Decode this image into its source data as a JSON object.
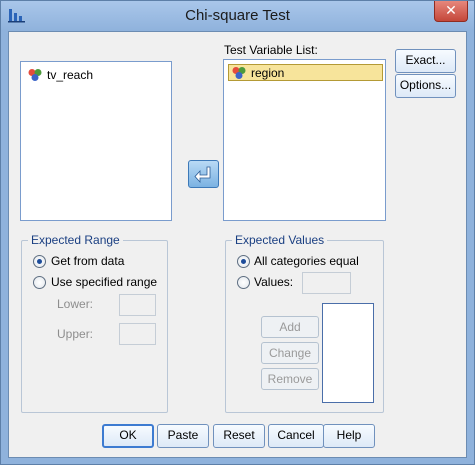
{
  "window": {
    "title": "Chi-square Test",
    "close_glyph": "✕"
  },
  "source_list": {
    "items": [
      {
        "label": "tv_reach",
        "icon": "nominal-variable-icon"
      }
    ]
  },
  "test_variable_list": {
    "label": "Test Variable List:",
    "items": [
      {
        "label": "region",
        "icon": "nominal-variable-icon",
        "selected": true
      }
    ]
  },
  "side_buttons": {
    "exact": "Exact...",
    "options": "Options..."
  },
  "expected_range": {
    "title": "Expected Range",
    "get_from_data": "Get from data",
    "get_from_data_checked": true,
    "use_specified_range": "Use specified range",
    "use_specified_range_checked": false,
    "lower_label": "Lower:",
    "upper_label": "Upper:"
  },
  "expected_values": {
    "title": "Expected Values",
    "all_categories_equal": "All categories equal",
    "all_categories_equal_checked": true,
    "values_label": "Values:",
    "values_checked": false,
    "add": "Add",
    "change": "Change",
    "remove": "Remove"
  },
  "footer": {
    "ok": "OK",
    "paste": "Paste",
    "reset": "Reset",
    "cancel": "Cancel",
    "help": "Help"
  },
  "colors": {
    "title_bar": "#8fb2dc",
    "selected_item": "#f7e49b",
    "group_title": "#1a3f82"
  }
}
